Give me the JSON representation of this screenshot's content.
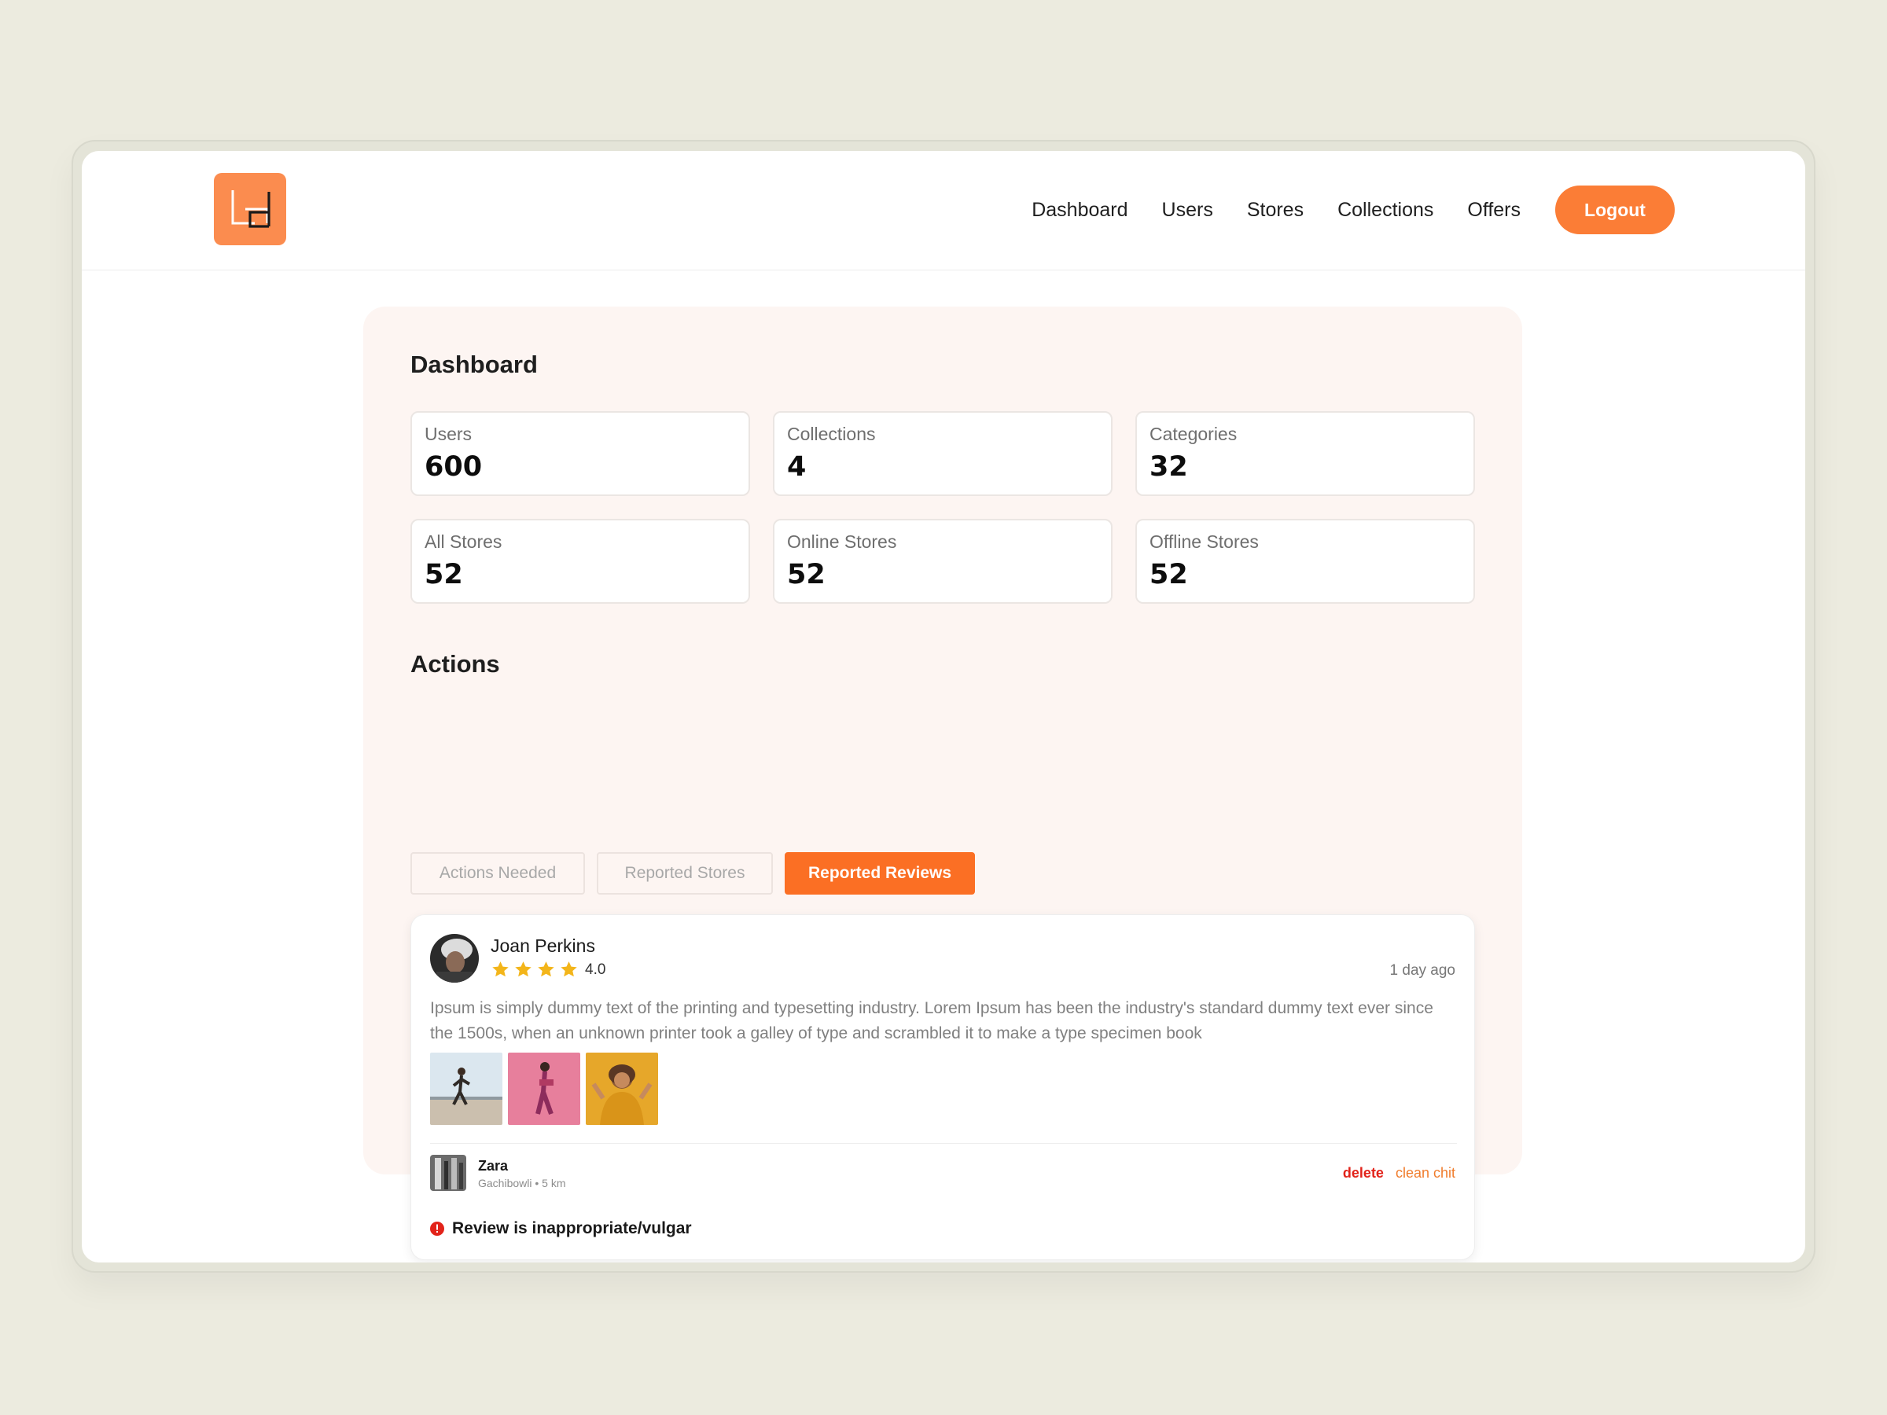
{
  "colors": {
    "accent": "#fb7d36",
    "tab_active": "#fb6f24",
    "panel_bg": "#fdf5f2",
    "star": "#f3b51a",
    "danger": "#e2231a",
    "clean_chit": "#f07c2c"
  },
  "header": {
    "logo_icon": "bd-logo-icon",
    "nav": [
      "Dashboard",
      "Users",
      "Stores",
      "Collections",
      "Offers"
    ],
    "logout_label": "Logout"
  },
  "dashboard": {
    "title": "Dashboard",
    "stats": [
      {
        "label": "Users",
        "value": "600"
      },
      {
        "label": "Collections",
        "value": "4"
      },
      {
        "label": "Categories",
        "value": "32"
      },
      {
        "label": "All Stores",
        "value": "52"
      },
      {
        "label": "Online Stores",
        "value": "52"
      },
      {
        "label": "Offline Stores",
        "value": "52"
      }
    ]
  },
  "actions": {
    "title": "Actions",
    "tabs": [
      "Actions Needed",
      "Reported Stores",
      "Reported Reviews"
    ],
    "active_tab": "Reported Reviews"
  },
  "review": {
    "reviewer": "Joan Perkins",
    "rating": 4,
    "rating_label": "4.0",
    "time_ago": "1 day ago",
    "text": "Ipsum is simply dummy text of the printing and typesetting industry. Lorem Ipsum has been the industry's standard dummy text ever since the 1500s, when an unknown printer took a galley of type and scrambled it to make a type specimen book",
    "store_name": "Zara",
    "store_meta": "Gachibowli • 5 km",
    "delete_label": "delete",
    "clean_chit_label": "clean chit",
    "flag_icon": "alert-circle-icon",
    "flag_text": "Review is inappropriate/vulgar"
  }
}
